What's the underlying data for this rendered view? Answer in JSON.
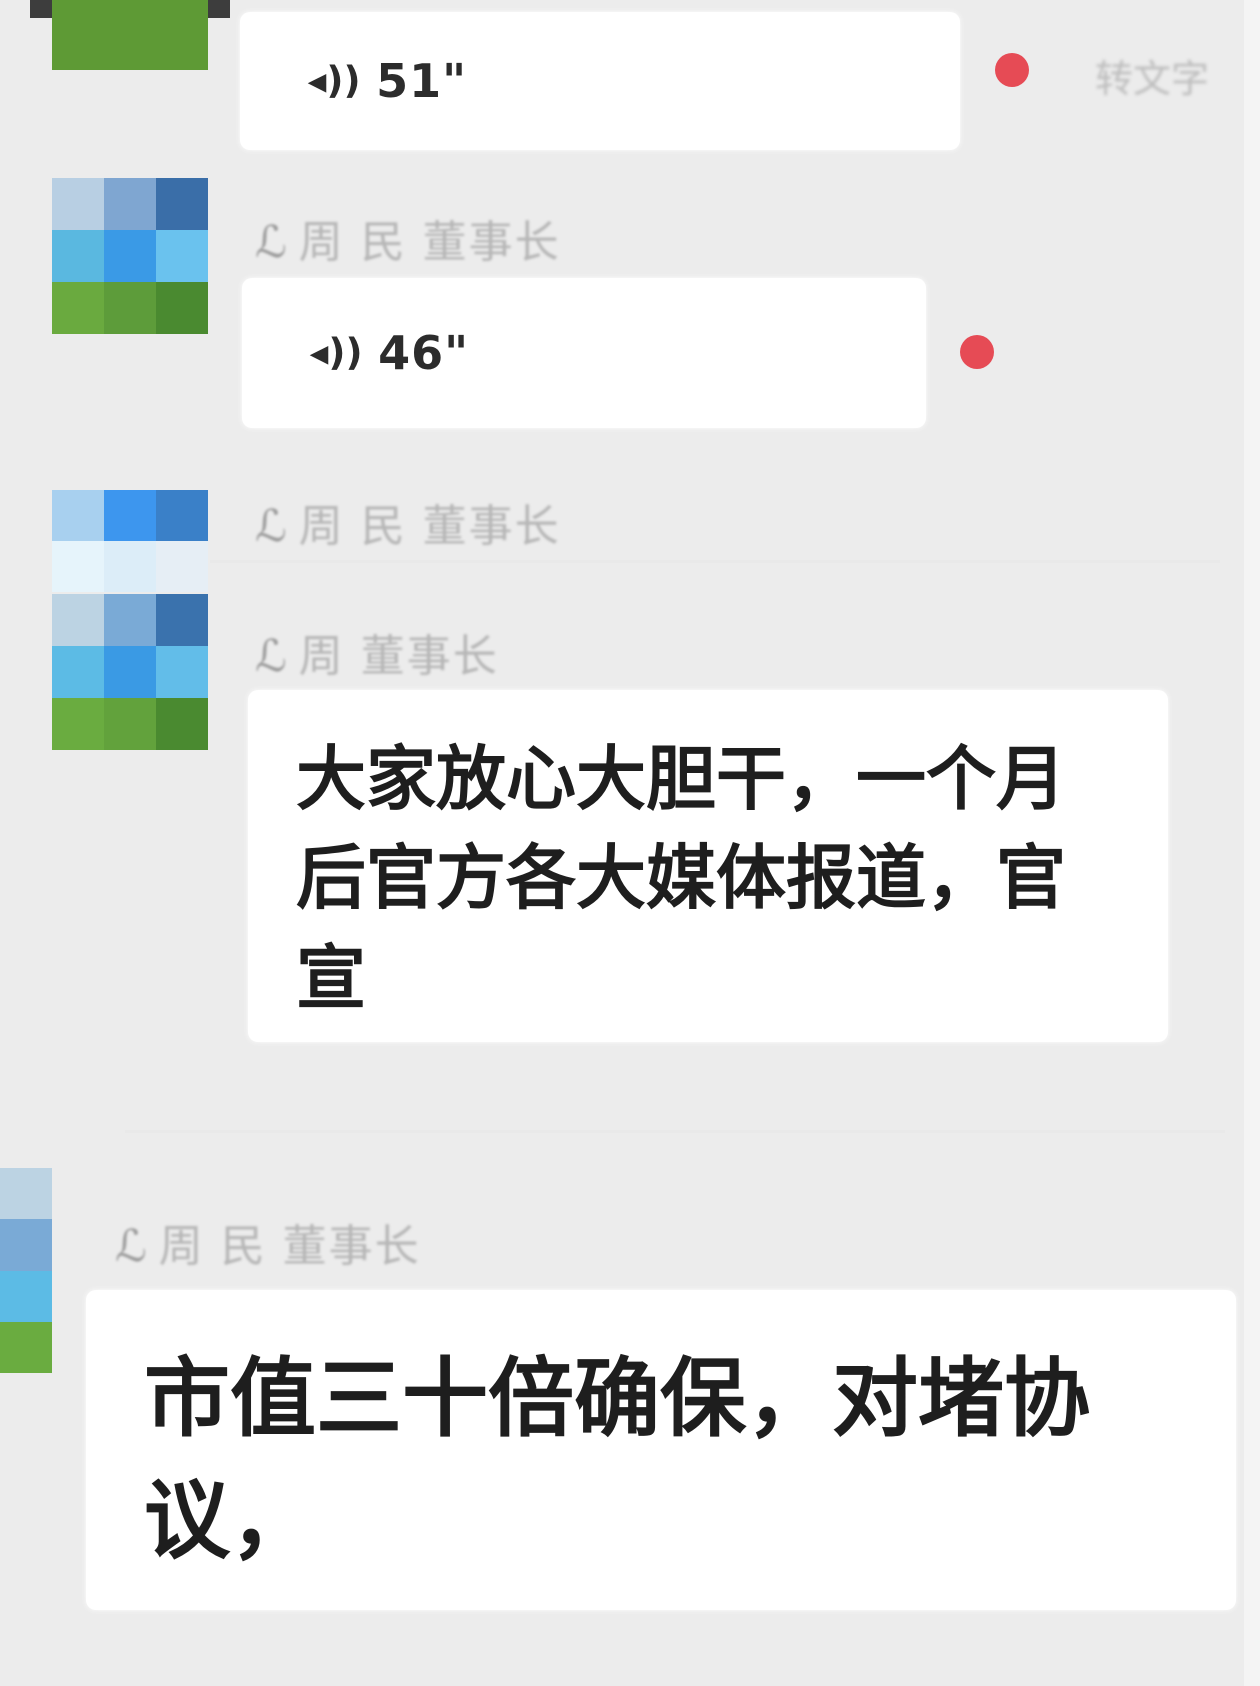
{
  "messages": [
    {
      "type": "voice",
      "duration": "51\"",
      "unread": true,
      "convert_label": "转文字"
    },
    {
      "sender": "周 民 董事长",
      "type": "voice",
      "duration": "46\"",
      "unread": true
    },
    {
      "sender": "周 民 董事长"
    },
    {
      "sender": "周 董事长",
      "type": "text",
      "text": "大家放心大胆干，一个月后官方各大媒体报道，官宣"
    },
    {
      "sender": "周 民 董事长",
      "type": "text",
      "text": "市值三十倍确保，对堵协议，"
    }
  ],
  "icons": {
    "voice": "voice-wave-icon",
    "sender_decoration": "crown-decoration-icon"
  },
  "colors": {
    "unread": "#e64b55",
    "bubble": "#ffffff",
    "background": "#ececec"
  }
}
